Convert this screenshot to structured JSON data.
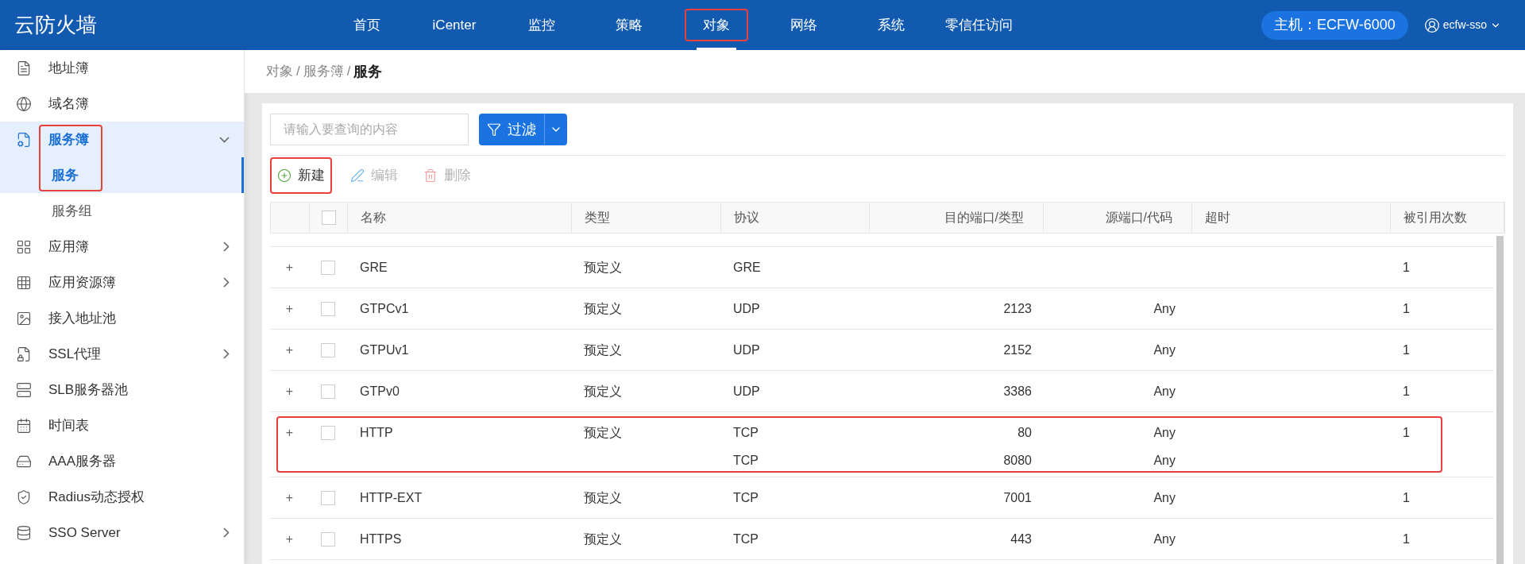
{
  "header": {
    "logo": "云防火墙",
    "nav": [
      {
        "label": "首页",
        "selected": false,
        "highlighted": false
      },
      {
        "label": "iCenter",
        "selected": false,
        "highlighted": false
      },
      {
        "label": "监控",
        "selected": false,
        "highlighted": false
      },
      {
        "label": "策略",
        "selected": false,
        "highlighted": false
      },
      {
        "label": "对象",
        "selected": true,
        "highlighted": true
      },
      {
        "label": "网络",
        "selected": false,
        "highlighted": false
      },
      {
        "label": "系统",
        "selected": false,
        "highlighted": false
      },
      {
        "label": "零信任访问",
        "selected": false,
        "highlighted": false
      }
    ],
    "host": "主机：ECFW-6000",
    "user": "ecfw-sso"
  },
  "sidebar": {
    "items": [
      {
        "label": "地址簿",
        "has_submenu": false
      },
      {
        "label": "域名簿",
        "has_submenu": false
      },
      {
        "label": "服务簿",
        "has_submenu": true,
        "expanded": true,
        "highlighted": true,
        "children": [
          {
            "label": "服务",
            "selected": true
          },
          {
            "label": "服务组",
            "selected": false
          }
        ]
      },
      {
        "label": "应用簿",
        "has_submenu": true
      },
      {
        "label": "应用资源簿",
        "has_submenu": true
      },
      {
        "label": "接入地址池",
        "has_submenu": false
      },
      {
        "label": "SSL代理",
        "has_submenu": true
      },
      {
        "label": "SLB服务器池",
        "has_submenu": false
      },
      {
        "label": "时间表",
        "has_submenu": false
      },
      {
        "label": "AAA服务器",
        "has_submenu": false
      },
      {
        "label": "Radius动态授权",
        "has_submenu": false
      },
      {
        "label": "SSO Server",
        "has_submenu": true
      }
    ]
  },
  "breadcrumb": {
    "items": [
      "对象",
      "服务簿",
      "服务"
    ],
    "separator": "/"
  },
  "search": {
    "placeholder": "请输入要查询的内容"
  },
  "filter_button": "过滤",
  "toolbar": [
    {
      "kind": "add",
      "label": "新建",
      "disabled": false,
      "highlighted": true
    },
    {
      "kind": "edit",
      "label": "编辑",
      "disabled": true,
      "highlighted": false
    },
    {
      "kind": "delete",
      "label": "删除",
      "disabled": true,
      "highlighted": false
    }
  ],
  "table": {
    "select_all_checked": false,
    "columns": [
      "名称",
      "类型",
      "协议",
      "目的端口/类型",
      "源端口/代码",
      "超时",
      "被引用次数"
    ],
    "rows": [
      {
        "expand": "+",
        "checked": false,
        "name": "GRE",
        "type": "预定义",
        "entries": [
          {
            "protocol": "GRE"
          }
        ],
        "references": "1",
        "highlighted": false
      },
      {
        "expand": "+",
        "checked": false,
        "name": "GTPCv1",
        "type": "预定义",
        "entries": [
          {
            "protocol": "UDP",
            "dst_port": "2123",
            "src_port": "Any"
          }
        ],
        "references": "1",
        "highlighted": false
      },
      {
        "expand": "+",
        "checked": false,
        "name": "GTPUv1",
        "type": "预定义",
        "entries": [
          {
            "protocol": "UDP",
            "dst_port": "2152",
            "src_port": "Any"
          }
        ],
        "references": "1",
        "highlighted": false
      },
      {
        "expand": "+",
        "checked": false,
        "name": "GTPv0",
        "type": "预定义",
        "entries": [
          {
            "protocol": "UDP",
            "dst_port": "3386",
            "src_port": "Any"
          }
        ],
        "references": "1",
        "highlighted": false
      },
      {
        "expand": "+",
        "checked": false,
        "name": "HTTP",
        "type": "预定义",
        "entries": [
          {
            "protocol": "TCP",
            "dst_port": "80",
            "src_port": "Any"
          },
          {
            "protocol": "TCP",
            "dst_port": "8080",
            "src_port": "Any"
          }
        ],
        "references": "1",
        "highlighted": true
      },
      {
        "expand": "+",
        "checked": false,
        "name": "HTTP-EXT",
        "type": "预定义",
        "entries": [
          {
            "protocol": "TCP",
            "dst_port": "7001",
            "src_port": "Any"
          }
        ],
        "references": "1",
        "highlighted": false
      },
      {
        "expand": "+",
        "checked": false,
        "name": "HTTPS",
        "type": "预定义",
        "entries": [
          {
            "protocol": "TCP",
            "dst_port": "443",
            "src_port": "Any"
          }
        ],
        "references": "1",
        "highlighted": false
      }
    ]
  }
}
